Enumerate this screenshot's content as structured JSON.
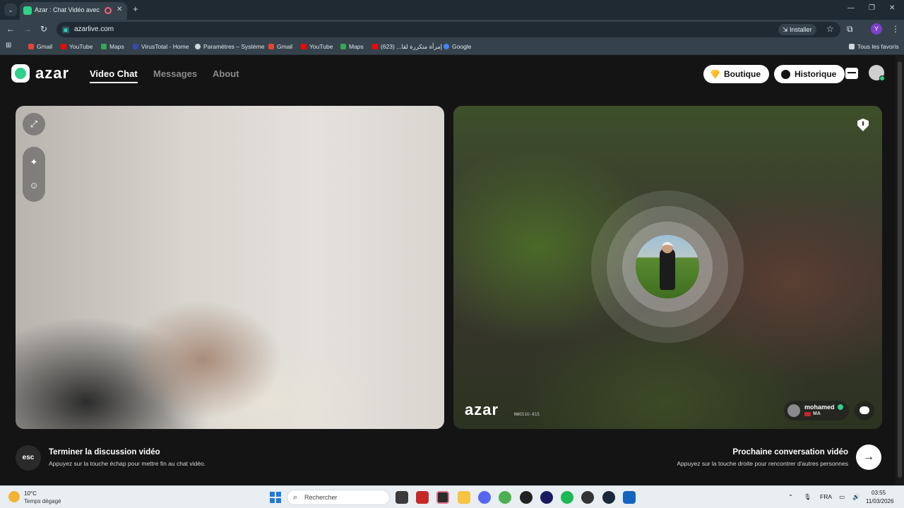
{
  "browser": {
    "tab_title": "Azar : Chat Vidéo avec de n",
    "url": "azarlive.com",
    "install_label": "Installer",
    "bookmarks": [
      "Gmail",
      "YouTube",
      "Maps",
      "VirusTotal - Home",
      "Paramètres – Système",
      "Gmail",
      "YouTube",
      "Maps",
      "إمرأة متكررة لقا... (623)",
      "Google"
    ],
    "all_bookmarks_label": "Tous les favoris"
  },
  "header": {
    "logo_text": "azar",
    "nav": [
      "Video Chat",
      "Messages",
      "About"
    ],
    "active_nav": "Video Chat",
    "boutique_label": "Boutique",
    "historique_label": "Historique"
  },
  "remote_video": {
    "watermark": "azar",
    "watermark_code": "NWG51U-815",
    "peer_name": "mohamed",
    "peer_country": "MA"
  },
  "controls": {
    "esc_key": "esc",
    "end_title": "Terminer la discussion vidéo",
    "end_subtitle": "Appuyez sur la touche échap pour mettre fin au chat vidéo.",
    "next_title": "Prochaine conversation vidéo",
    "next_subtitle": "Appuyez sur la touche droite pour rencontrer d'autres personnes"
  },
  "taskbar": {
    "weather_temp": "10°C",
    "weather_desc": "Temps dégagé",
    "search_placeholder": "Rechercher",
    "language": "FRA",
    "time": "03:55",
    "date": "11/03/2026"
  },
  "colors": {
    "brand_green": "#2fd08a",
    "page_bg": "#141414",
    "browser_bg": "#35424c"
  }
}
